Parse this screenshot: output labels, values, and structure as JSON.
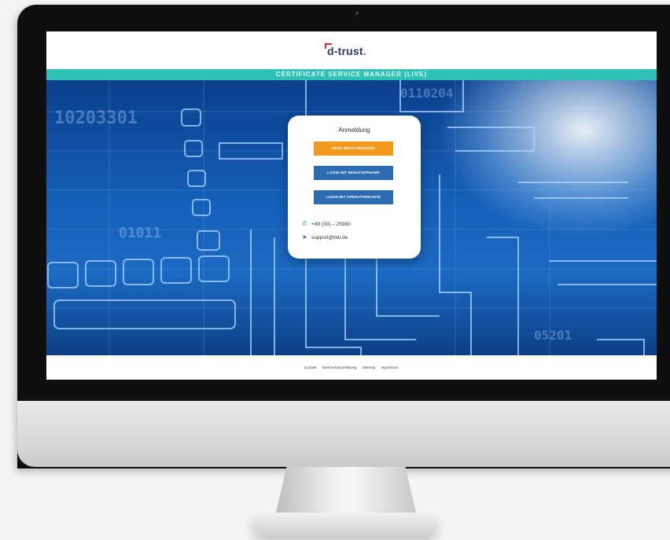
{
  "header": {
    "logo_text": "d-trust",
    "logo_dot": "."
  },
  "banner": {
    "title": "CERTIFICATE SERVICE MANAGER (LIVE)"
  },
  "hero": {
    "bg_numbers": [
      "10203301",
      "01011",
      "0110204",
      "05201"
    ]
  },
  "login": {
    "title": "Anmeldung",
    "buttons": [
      {
        "label": "NEUE REGISTRIERUNG",
        "color": "#f39a1e"
      },
      {
        "label": "LOGIN MIT BENUTZERNAME",
        "color": "#2b6cb3"
      },
      {
        "label": "LOGIN MIT OPERATORKARTE",
        "color": "#2b6cb3"
      }
    ],
    "phone": {
      "icon": "phone-icon",
      "text": "+49 (30) – 25980"
    },
    "email": {
      "icon": "paper-plane-icon",
      "text": "support@bdr.de"
    }
  },
  "footer": {
    "links": [
      "Kontakt",
      "Datenschutzerklärung",
      "Sitemap",
      "Impressum"
    ]
  },
  "colors": {
    "accent_teal": "#2ec2b6",
    "brand_navy": "#2b3a67",
    "brand_red": "#e3322a",
    "button_orange": "#f39a1e",
    "button_blue": "#2b6cb3"
  }
}
